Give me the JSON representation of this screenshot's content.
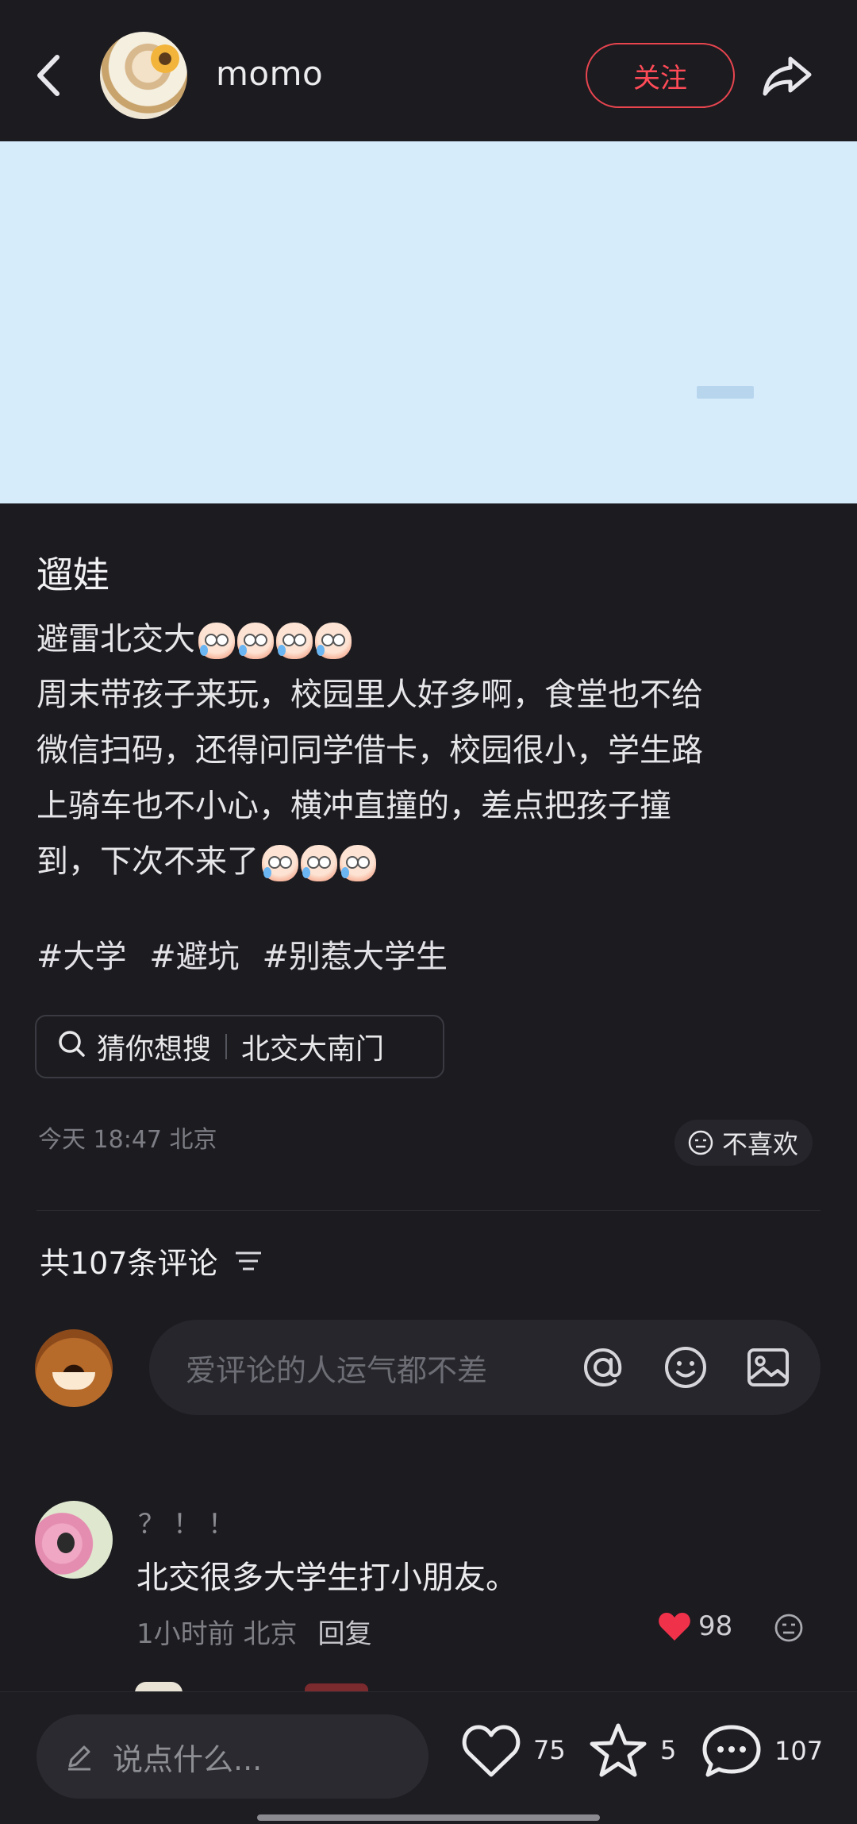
{
  "header": {
    "author_name": "momo",
    "follow_label": "关注"
  },
  "post": {
    "title": "遛娃",
    "lines": [
      "避雷北交大",
      "周末带孩子来玩，校园里人好多啊，食堂也不给",
      "微信扫码，还得问同学借卡，校园很小，学生路",
      "上骑车也不小心，横冲直撞的，差点把孩子撞",
      "到，下次不来了"
    ],
    "tags": [
      "#大学",
      "#避坑",
      "#别惹大学生"
    ],
    "search_hint_label": "猜你想搜",
    "search_hint_value": "北交大南门",
    "meta": "今天 18:47 北京",
    "dislike_label": "不喜欢"
  },
  "comments": {
    "count_label": "共107条评论",
    "input_placeholder": "爱评论的人运气都不差",
    "items": [
      {
        "name": "？！！",
        "text": "北交很多大学生打小朋友。",
        "time_location": "1小时前 北京",
        "reply_label": "回复",
        "likes": "98"
      }
    ]
  },
  "bottom_bar": {
    "input_placeholder": "说点什么...",
    "likes": "75",
    "favorites": "5",
    "comments": "107"
  },
  "colors": {
    "background": "#1b1b20",
    "accent": "#ff4b57",
    "media_placeholder": "#d6ecfb"
  },
  "icons": [
    "back-arrow-icon",
    "share-icon",
    "search-icon",
    "dislike-face-icon",
    "filter-icon",
    "at-icon",
    "emoji-icon",
    "image-icon",
    "heart-icon",
    "star-icon",
    "comment-bubble-icon",
    "pencil-icon"
  ]
}
